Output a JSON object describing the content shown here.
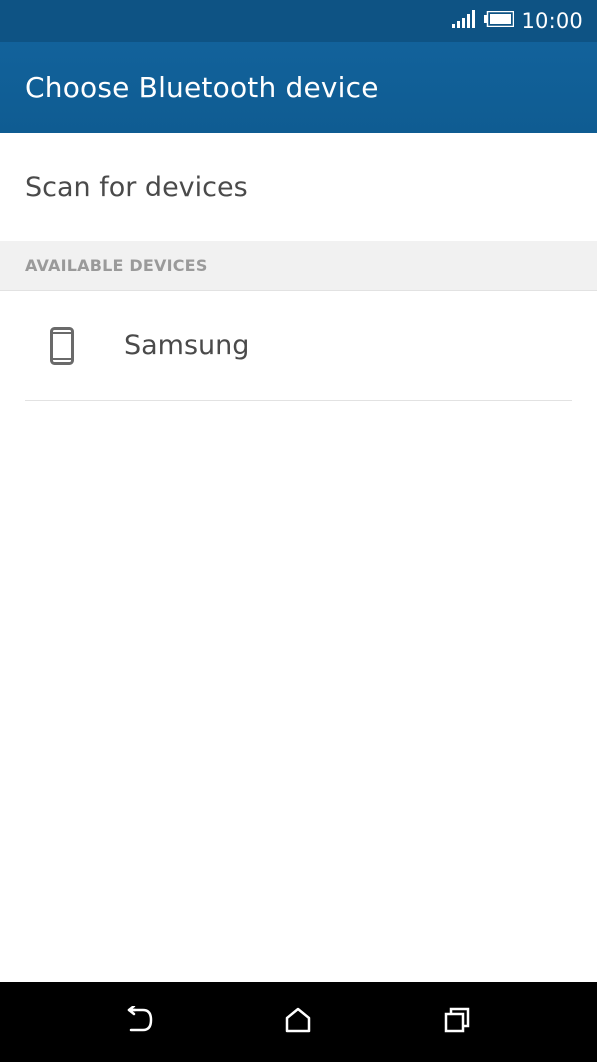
{
  "status_bar": {
    "time": "10:00",
    "icons": [
      "signal-icon",
      "battery-icon"
    ]
  },
  "app_bar": {
    "title": "Choose Bluetooth device"
  },
  "scan": {
    "label": "Scan for devices"
  },
  "section": {
    "available_label": "AVAILABLE DEVICES"
  },
  "devices": [
    {
      "name": "Samsung",
      "icon": "phone-icon"
    }
  ],
  "nav_bar": {
    "icons": [
      "back-icon",
      "home-icon",
      "recents-icon"
    ]
  },
  "colors": {
    "status_bar": "#0e5384",
    "app_bar": "#12629b",
    "section_header_bg": "#f1f1f1",
    "section_header_text": "#9a9a9a",
    "primary_text": "#4a4a4a",
    "nav_bar": "#000000"
  }
}
